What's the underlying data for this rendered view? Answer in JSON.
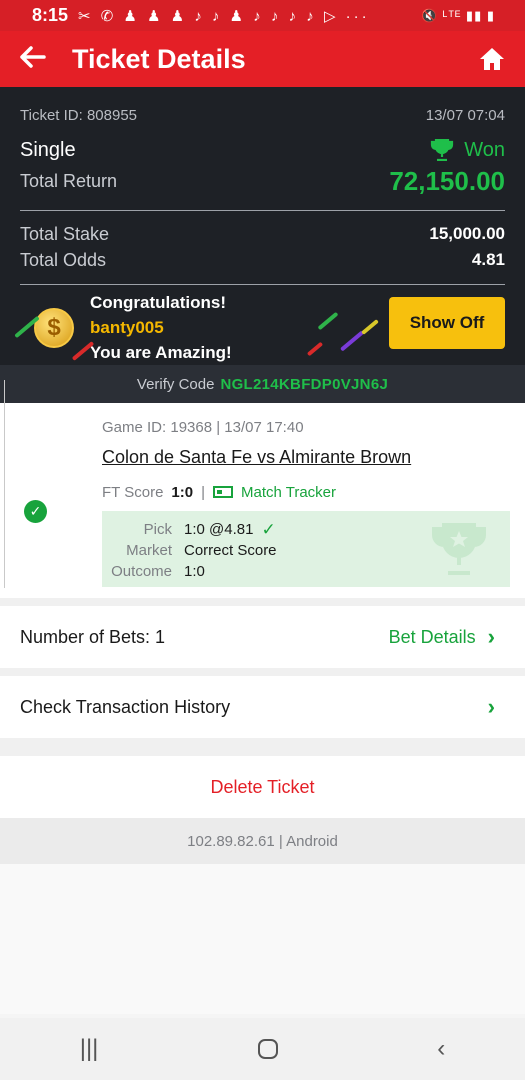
{
  "status_bar": {
    "time": "8:15",
    "notifications": "✂ ✆ ♟ ♟ ♟ ♪ ♪ ♟ ♪ ♪ ♪ ♪ ▷ ···",
    "system": "🔇 ᴸᵀᴱ ▮▮ ▮"
  },
  "header": {
    "title": "Ticket Details",
    "back_icon": "arrow-left-icon",
    "home_icon": "home-icon"
  },
  "ticket": {
    "id_label": "Ticket ID: 808955",
    "datetime": "13/07 07:04",
    "bet_type": "Single",
    "status": "Won",
    "total_return_label": "Total Return",
    "total_return": "72,150.00",
    "total_stake_label": "Total Stake",
    "total_stake": "15,000.00",
    "total_odds_label": "Total Odds",
    "total_odds": "4.81"
  },
  "congrats": {
    "line1": "Congratulations!",
    "username": "banty005",
    "line3": "You are Amazing!",
    "button": "Show Off",
    "coin_symbol": "$"
  },
  "verify": {
    "label": "Verify Code",
    "code": "NGL214KBFDP0VJN6J"
  },
  "game": {
    "game_id": "Game ID: 19368 | 13/07 17:40",
    "teams": "Colon de Santa Fe vs Almirante Brown",
    "ft_label": "FT Score",
    "ft_score": "1:0",
    "separator": "|",
    "tracker": "Match Tracker",
    "pick_label": "Pick",
    "pick_value": "1:0 @4.81",
    "market_label": "Market",
    "market_value": "Correct Score",
    "outcome_label": "Outcome",
    "outcome_value": "1:0"
  },
  "bets": {
    "label": "Number of Bets: 1",
    "details": "Bet Details"
  },
  "history": {
    "label": "Check Transaction History"
  },
  "delete": {
    "label": "Delete Ticket"
  },
  "footer": {
    "ip": "102.89.82.61 | Android"
  },
  "colors": {
    "brand_red": "#e41f26",
    "win_green": "#1fbf4a",
    "accent_yellow": "#f7c00d",
    "dark_bg": "#1e2126"
  }
}
